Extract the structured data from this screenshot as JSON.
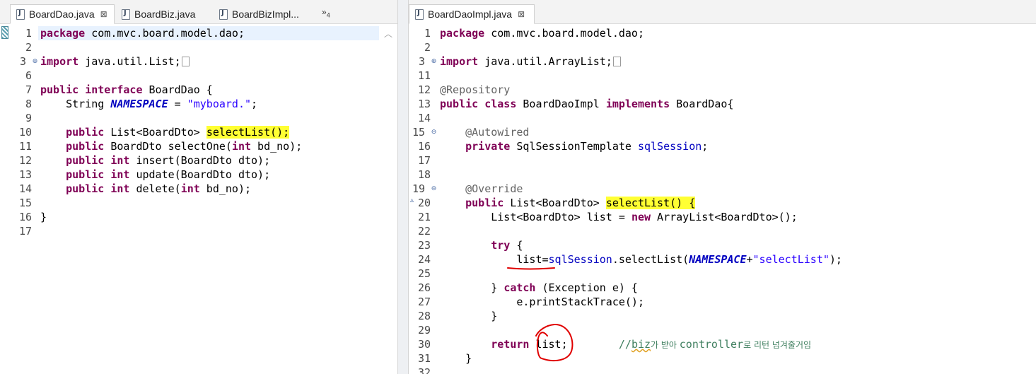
{
  "left_editor": {
    "tabs": [
      {
        "label": "BoardDao.java",
        "close": "⊠"
      },
      {
        "label": "BoardBiz.java"
      },
      {
        "label": "BoardBizImpl..."
      }
    ],
    "overflow": {
      "label": "»",
      "count": "4"
    },
    "line_numbers": [
      "1",
      "2",
      "3",
      "6",
      "7",
      "8",
      "9",
      "10",
      "11",
      "12",
      "13",
      "14",
      "15",
      "16",
      "17"
    ],
    "lines": {
      "l1": {
        "kw": "package",
        "rest": " com.mvc.board.model.dao;"
      },
      "l3": {
        "kw": "import",
        "rest": " java.util.List;"
      },
      "l7": {
        "kw1": "public",
        "kw2": "interface",
        "rest": " BoardDao {"
      },
      "l8": {
        "pre": "    String ",
        "const": "NAMESPACE",
        "mid": " = ",
        "str": "\"myboard.\"",
        "end": ";"
      },
      "l10": {
        "kw": "public",
        "mid": " List<BoardDto> ",
        "hl": "selectList();"
      },
      "l11": {
        "kw": "public",
        "mid": " BoardDto selectOne(",
        "kw2": "int",
        "end": " bd_no);"
      },
      "l12": {
        "kw": "public",
        "kw2": "int",
        "end": " insert(BoardDto dto);"
      },
      "l13": {
        "kw": "public",
        "kw2": "int",
        "end": " update(BoardDto dto);"
      },
      "l14": {
        "kw": "public",
        "kw2": "int",
        "mid": " delete(",
        "kw3": "int",
        "end": " bd_no);"
      },
      "l16": {
        "text": "}"
      }
    }
  },
  "right_editor": {
    "tabs": [
      {
        "label": "BoardDaoImpl.java",
        "close": "⊠"
      }
    ],
    "line_numbers": [
      "1",
      "2",
      "3",
      "11",
      "12",
      "13",
      "14",
      "15",
      "16",
      "17",
      "18",
      "19",
      "20",
      "21",
      "22",
      "23",
      "24",
      "25",
      "26",
      "27",
      "28",
      "29",
      "30",
      "31",
      "32"
    ],
    "lines": {
      "l1": {
        "kw": "package",
        "rest": " com.mvc.board.model.dao;"
      },
      "l3": {
        "kw": "import",
        "rest": " java.util.ArrayList;"
      },
      "l12": {
        "ann": "@Repository"
      },
      "l13": {
        "kw1": "public",
        "kw2": "class",
        "mid": " BoardDaoImpl ",
        "kw3": "implements",
        "end": " BoardDao{"
      },
      "l15": {
        "ann": "@Autowired"
      },
      "l16": {
        "kw": "private",
        "mid": " SqlSessionTemplate ",
        "fld": "sqlSession",
        "end": ";"
      },
      "l19": {
        "ann": "@Override"
      },
      "l20": {
        "kw": "public",
        "mid": " List<BoardDto> ",
        "hl": "selectList() {"
      },
      "l21": {
        "pre": "List<BoardDto> list = ",
        "kw": "new",
        "end": " ArrayList<BoardDto>();"
      },
      "l23": {
        "kw": "try",
        "end": " {"
      },
      "l24": {
        "a": "list=",
        "fld": "sqlSession",
        "b": ".selectList(",
        "const": "NAMESPACE",
        "c": "+",
        "str": "\"selectList\"",
        "d": ");"
      },
      "l26": {
        "a": "} ",
        "kw": "catch",
        "b": " (Exception e) {"
      },
      "l27": {
        "text": "e.printStackTrace();"
      },
      "l28": {
        "text": "}"
      },
      "l30": {
        "kw": "return",
        "b": " list;",
        "cmt1": "//",
        "cmt2": "biz",
        "cmt3": "가 받아 ",
        "cmt4": "controller",
        "cmt5": "로 리턴 넘겨줄거임"
      },
      "l31": {
        "text": "}"
      }
    }
  },
  "colors": {
    "keyword": "#7f0055",
    "string": "#2a00ff",
    "annotation": "#646464",
    "field": "#0000c0",
    "comment": "#3f7f5f",
    "highlight": "#ffff33",
    "pen_annotation": "#e00000"
  },
  "icons": [
    "java-file-icon",
    "close-tab-icon",
    "fold-expand-icon",
    "fold-collapse-icon",
    "override-marker-icon",
    "scroll-up-icon"
  ]
}
